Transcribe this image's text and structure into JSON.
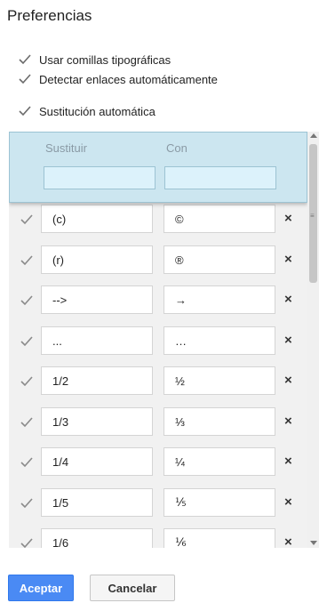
{
  "page": {
    "title": "Preferencias"
  },
  "options": [
    {
      "label": "Usar comillas tipográficas",
      "checked": true
    },
    {
      "label": "Detectar enlaces automáticamente",
      "checked": true
    },
    {
      "label": "Sustitución automática",
      "checked": true
    }
  ],
  "table": {
    "header": {
      "col_replace": "Sustituir",
      "col_with": "Con"
    },
    "rows": [
      {
        "from": "(c)",
        "to": "©",
        "checked": true
      },
      {
        "from": "(r)",
        "to": "®",
        "checked": true
      },
      {
        "from": "-->",
        "to": "→",
        "checked": true
      },
      {
        "from": "...",
        "to": "…",
        "checked": true
      },
      {
        "from": "1/2",
        "to": "½",
        "checked": true
      },
      {
        "from": "1/3",
        "to": "⅓",
        "checked": true
      },
      {
        "from": "1/4",
        "to": "¼",
        "checked": true
      },
      {
        "from": "1/5",
        "to": "⅕",
        "checked": true
      },
      {
        "from": "1/6",
        "to": "⅙",
        "checked": true
      }
    ],
    "delete_glyph": "×"
  },
  "buttons": {
    "accept": "Aceptar",
    "cancel": "Cancelar"
  },
  "colors": {
    "primary": "#4a8af4",
    "header_bg": "#cce6f0",
    "panel_bg": "#f1f1f1"
  },
  "icons": {
    "checkbox": "checkmark-icon",
    "delete": "close-icon"
  }
}
